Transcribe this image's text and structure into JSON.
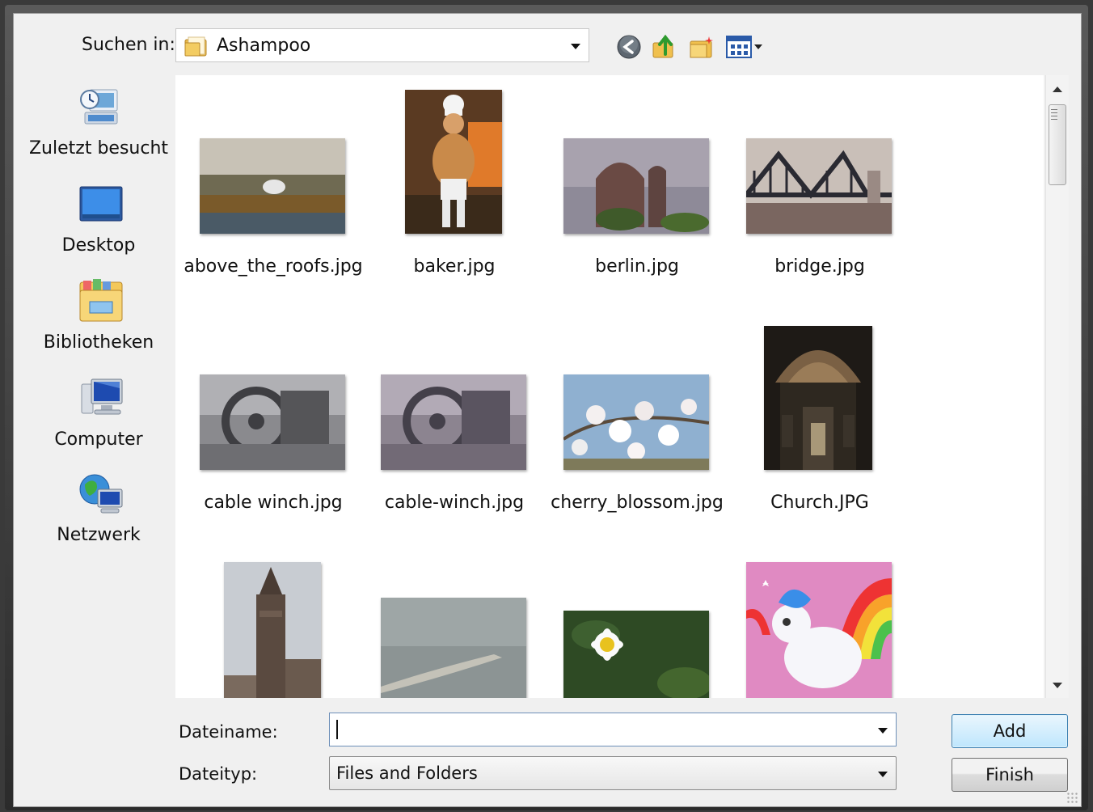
{
  "lookin": {
    "label": "Suchen in:",
    "value": "Ashampoo"
  },
  "toolbar": {
    "icons": [
      "back-icon",
      "up-folder-icon",
      "new-folder-icon",
      "view-menu-icon"
    ]
  },
  "places": [
    {
      "label": "Zuletzt besucht",
      "icon": "recent-places-icon"
    },
    {
      "label": "Desktop",
      "icon": "desktop-icon"
    },
    {
      "label": "Bibliotheken",
      "icon": "libraries-icon"
    },
    {
      "label": "Computer",
      "icon": "computer-icon"
    },
    {
      "label": "Netzwerk",
      "icon": "network-icon"
    }
  ],
  "files": [
    {
      "name": "above_the_roofs.jpg"
    },
    {
      "name": "baker.jpg"
    },
    {
      "name": "berlin.jpg"
    },
    {
      "name": "bridge.jpg"
    },
    {
      "name": "cable winch.jpg"
    },
    {
      "name": "cable-winch.jpg"
    },
    {
      "name": "cherry_blossom.jpg"
    },
    {
      "name": "Church.JPG"
    },
    {
      "name": ""
    },
    {
      "name": ""
    },
    {
      "name": ""
    },
    {
      "name": ""
    }
  ],
  "form": {
    "filename_label": "Dateiname:",
    "filename_value": "",
    "filetype_label": "Dateityp:",
    "filetype_value": "Files and Folders"
  },
  "buttons": {
    "add": "Add",
    "finish": "Finish"
  },
  "colors": {
    "accent": "#3c7fb1",
    "dialog_bg": "#f0f0f0",
    "view_bg": "#ffffff"
  }
}
